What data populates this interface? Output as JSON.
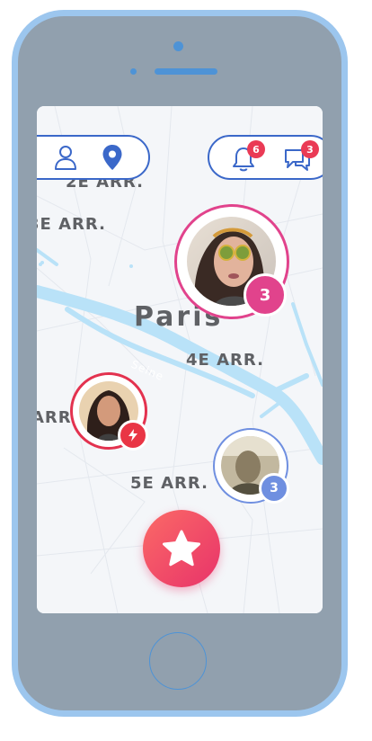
{
  "topbar": {
    "profile_icon": "user-icon",
    "location_icon": "map-pin-icon",
    "notifications_icon": "bell-icon",
    "notifications_count": "6",
    "messages_icon": "chat-icon",
    "messages_count": "3"
  },
  "map": {
    "city_label": "Paris",
    "districts": [
      "2E ARR.",
      "3E ARR.",
      "4E ARR.",
      "ARR.",
      "5E ARR."
    ],
    "river_label": "Seine"
  },
  "markers": [
    {
      "count": "3",
      "ring_color": "#e1438c",
      "badge_color": "#e1438c"
    },
    {
      "badge_icon": "lightning-icon",
      "ring_color": "#e3324f",
      "badge_color": "#e93545"
    },
    {
      "count": "3",
      "ring_color": "#6f8fe0",
      "badge_color": "#6f8fe0"
    }
  ],
  "fab": {
    "icon": "star-icon"
  },
  "colors": {
    "accent_blue": "#3b68c9",
    "accent_pink": "#e8336a",
    "badge_red": "#ea3a55"
  }
}
